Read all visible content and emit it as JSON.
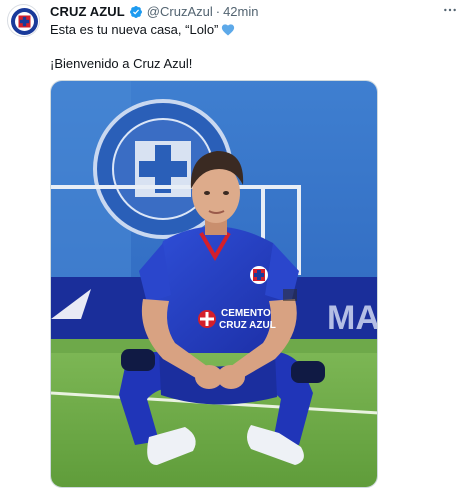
{
  "account": {
    "name": "CRUZ AZUL",
    "handle": "@CruzAzul",
    "separator": "·",
    "time": "42min"
  },
  "post": {
    "line1": "Esta es tu nueva casa, “Lolo”",
    "line2": "¡Bienvenido a Cruz Azul!",
    "emoji": "blue-heart-icon"
  },
  "media": {
    "jersey_text_line1": "CEMENTO",
    "jersey_text_line2": "CRUZ AZUL",
    "board_text": "MA"
  },
  "icons": {
    "verified": "verified-badge-icon",
    "more": "more-options-icon"
  },
  "colors": {
    "verified": "#1d9bf0",
    "heart": "#5da9e9",
    "club_blue": "#1f3fb0",
    "club_red": "#d41f2b"
  }
}
